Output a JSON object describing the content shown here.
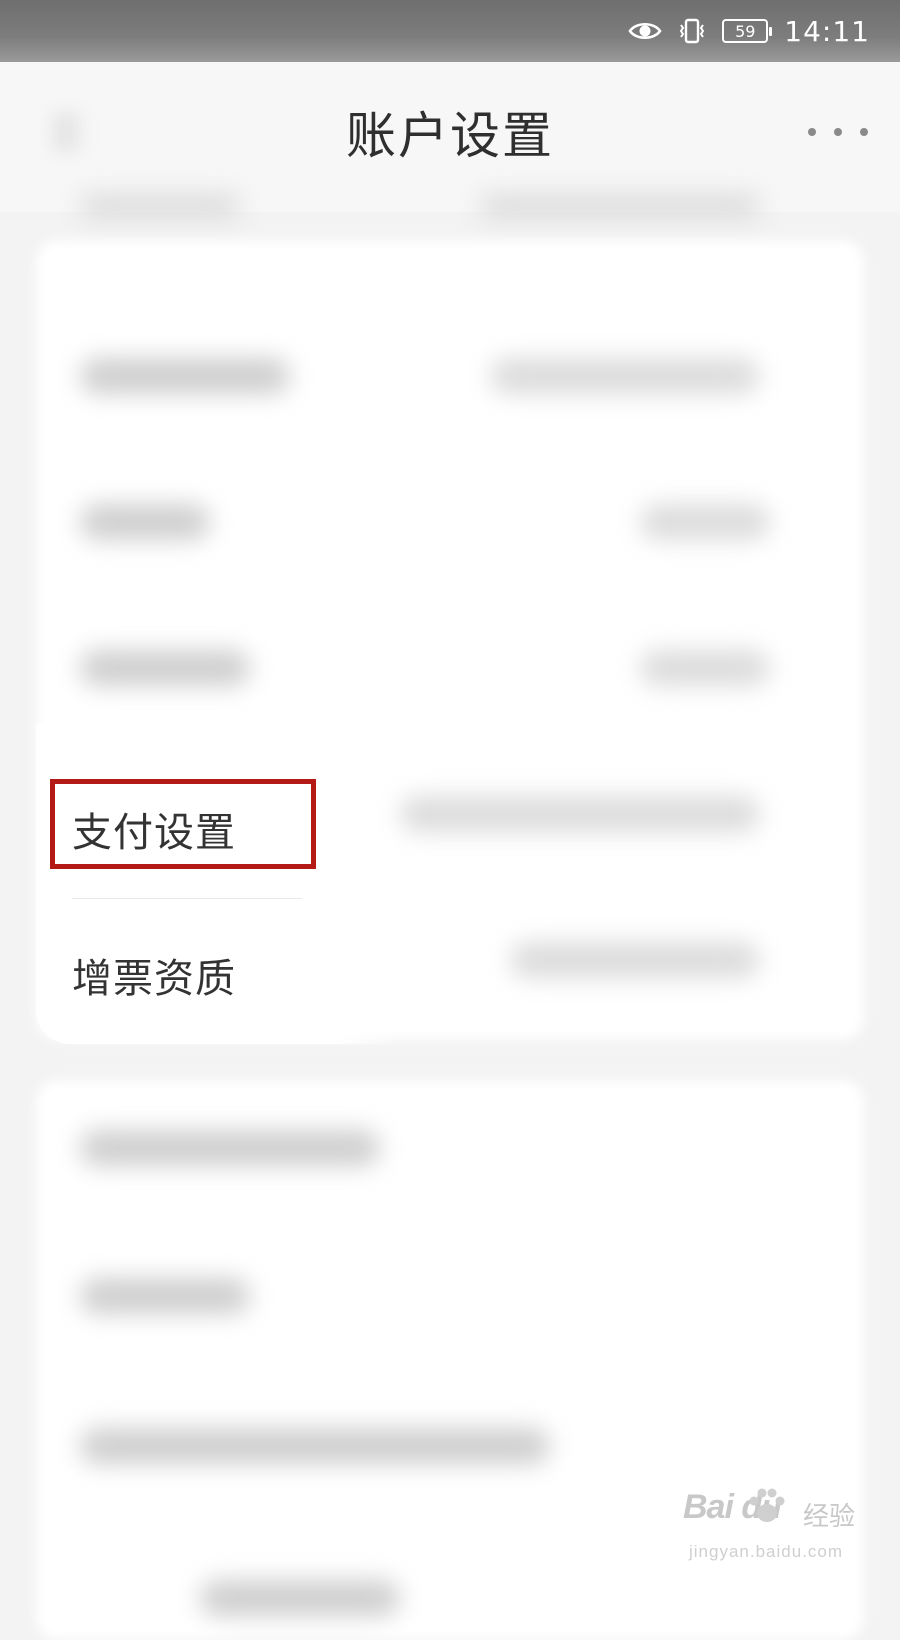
{
  "status_bar": {
    "battery_level": "59",
    "time": "14:11",
    "icons": [
      "eye-icon",
      "vibrate-icon",
      "battery-icon"
    ]
  },
  "header": {
    "title": "账户设置",
    "more_icon": "more-horizontal-icon"
  },
  "menu": {
    "items": [
      {
        "label": "支付设置",
        "highlighted": true
      },
      {
        "label": "增票资质",
        "highlighted": false
      }
    ]
  },
  "colors": {
    "highlight_border": "#b31a16",
    "status_bar": "#767676",
    "background": "#f3f3f3"
  },
  "watermark": {
    "brand": "Bai du",
    "brand_cn": "经验",
    "url": "jingyan.baidu.com"
  }
}
